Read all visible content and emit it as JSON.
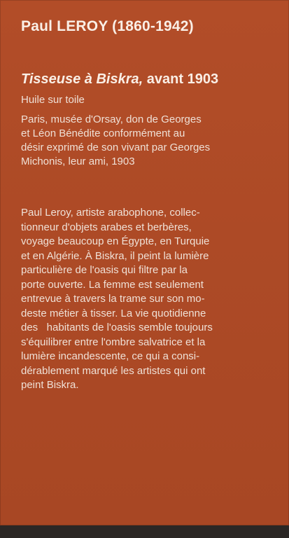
{
  "label": {
    "artist": "Paul LEROY (1860-1942)",
    "title_italic": "Tisseuse à Biskra,",
    "title_date": "avant 1903",
    "medium": "Huile sur toile",
    "provenance_lines": [
      "Paris, musée d'Orsay, don de Georges",
      "et Léon Bénédite conformément au",
      "désir exprimé de son vivant par Georges",
      "Michonis, leur ami, 1903"
    ],
    "description_lines": [
      "Paul Leroy, artiste arabophone, collec-",
      "tionneur d'objets arabes et berbères,",
      "voyage beaucoup en Égypte, en Turquie",
      "et en Algérie. À Biskra, il peint la lumière",
      "particulière de l'oasis qui filtre par la",
      "porte ouverte. La femme est seulement",
      "entrevue à travers la trame sur son mo-",
      "deste métier à tisser. La vie quotidienne",
      "des   habitants de l'oasis semble toujours",
      "s'équilibrer entre l'ombre salvatrice et la",
      "lumière incandescente, ce qui a consi-",
      "dérablement marqué les artistes qui ont",
      "peint Biskra."
    ]
  },
  "colors": {
    "panel": "#b24d28",
    "text": "#f3e6dc",
    "surround": "#2a2623"
  }
}
